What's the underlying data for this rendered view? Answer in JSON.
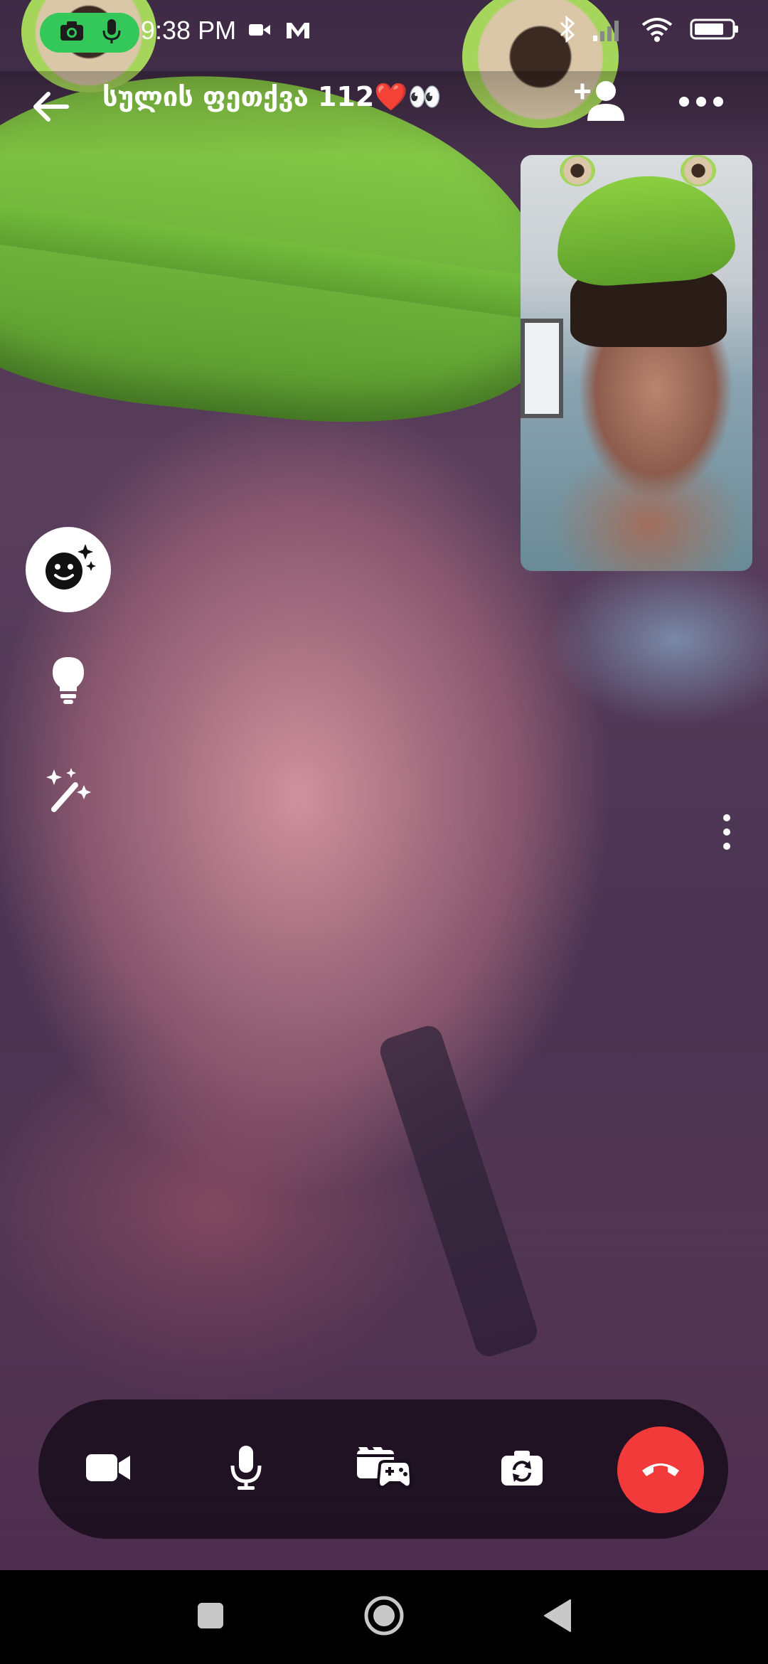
{
  "status_bar": {
    "time": "9:38 PM",
    "left_icons": [
      "camera-icon",
      "microphone-icon",
      "video-camera-icon",
      "app-m-icon"
    ],
    "right_icons": [
      "bluetooth-icon",
      "signal-icon",
      "wifi-icon",
      "battery-icon"
    ],
    "recording_indicator_color": "#34c759"
  },
  "header": {
    "title": "სულის ფეთქვა 112❤️👀",
    "back_icon": "arrow-left-icon",
    "add_person_icon": "add-person-icon",
    "more_icon": "more-horizontal-icon"
  },
  "side_controls": {
    "effects_icon": "smiley-sparkle-icon",
    "lightbulb_icon": "lightbulb-icon",
    "magic_icon": "magic-wand-icon",
    "more_icon": "more-vertical-icon"
  },
  "controls": {
    "video_icon": "video-camera-icon",
    "mic_icon": "microphone-icon",
    "games_icon": "clapper-gamepad-icon",
    "flip_icon": "camera-switch-icon",
    "end_icon": "phone-hangup-icon",
    "end_color": "#f23a3a"
  },
  "nav": {
    "recents_icon": "square-icon",
    "home_icon": "circle-icon",
    "back_icon": "triangle-back-icon"
  }
}
